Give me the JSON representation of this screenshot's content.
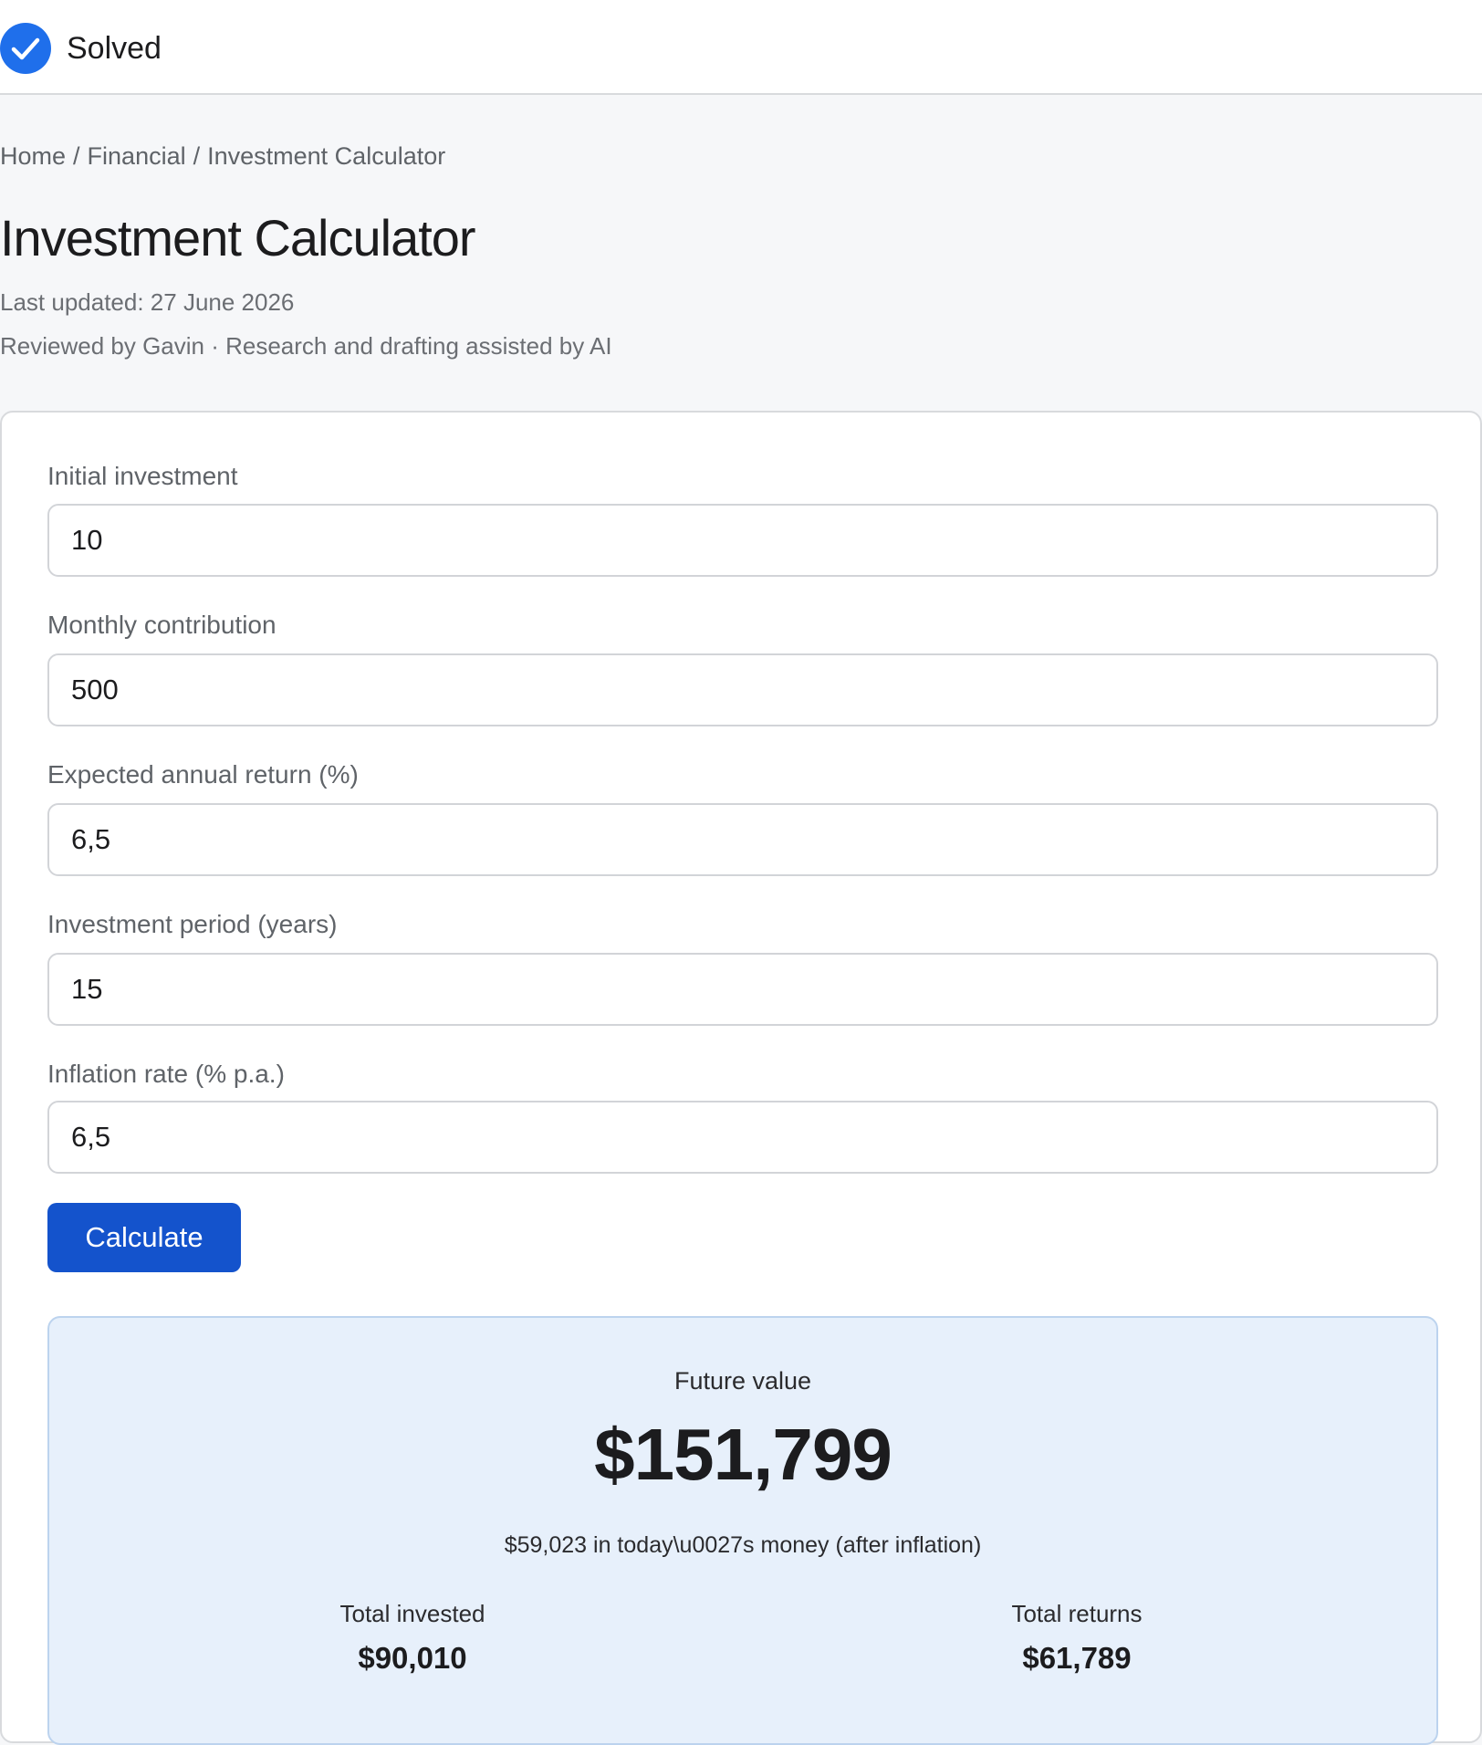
{
  "header": {
    "status_label": "Solved",
    "status_icon": "check-circle-icon",
    "accent_color": "#1f6feb"
  },
  "breadcrumb": {
    "items": [
      "Home",
      "Financial",
      "Investment Calculator"
    ],
    "separator": "/"
  },
  "page": {
    "title": "Investment Calculator",
    "last_updated": "Last updated: 27 June 2026",
    "reviewed_by": "Reviewed by Gavin · Research and drafting assisted by AI"
  },
  "form": {
    "fields": [
      {
        "label": "Initial investment",
        "value": "10"
      },
      {
        "label": "Monthly contribution",
        "value": "500"
      },
      {
        "label": "Expected annual return (%)",
        "value": "6,5"
      },
      {
        "label": "Investment period (years)",
        "value": "15"
      },
      {
        "label": "Inflation rate (% p.a.)",
        "value": "6,5"
      }
    ],
    "calculate_label": "Calculate",
    "button_color": "#1453cc"
  },
  "results": {
    "future_value_label": "Future value",
    "future_value": "$151,799",
    "real_value_note": "$59,023 in today\\u0027s money (after inflation)",
    "total_invested_label": "Total invested",
    "total_invested": "$90,010",
    "total_returns_label": "Total returns",
    "total_returns": "$61,789",
    "panel_color": "#e7f0fb"
  }
}
